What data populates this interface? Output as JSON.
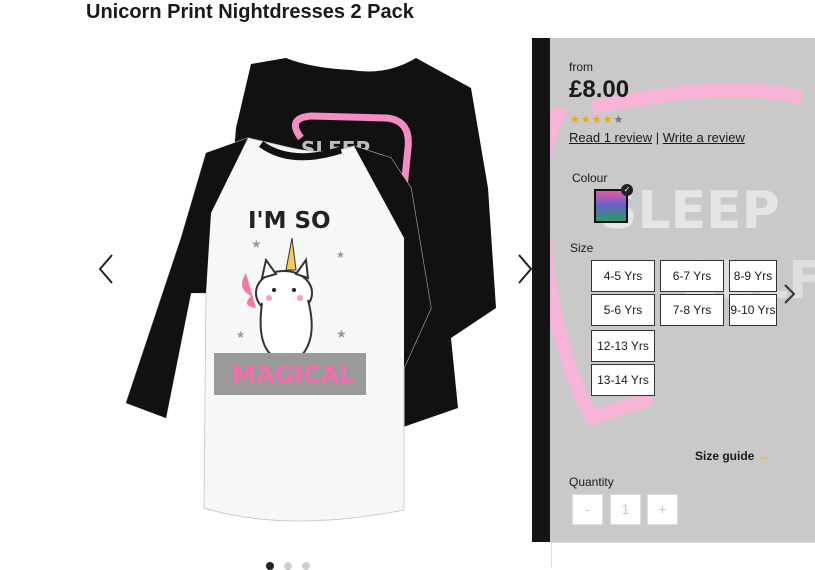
{
  "product": {
    "title": "Unicorn Print Nightdresses 2 Pack",
    "price_from": "from",
    "price": "£8.00",
    "rating": 4,
    "rating_max": 5,
    "review_link": "Read 1 review",
    "review_separator": "|",
    "write_review": "Write a review"
  },
  "gallery": {
    "front_text_top": "I'M SO",
    "front_text_bottom": "MAGICAL",
    "back_text": "SLEEP",
    "dots": [
      true,
      false,
      false
    ]
  },
  "options": {
    "colour_label": "Colour",
    "size_label": "Size",
    "sizes": [
      "4-5 Yrs",
      "6-7 Yrs",
      "8-9 Yrs",
      "5-6 Yrs",
      "7-8 Yrs",
      "9-10 Yrs",
      "12-13 Yrs",
      "13-14 Yrs"
    ],
    "size_guide": "Size guide",
    "size_guide_arrow": "→"
  },
  "quantity": {
    "label": "Quantity",
    "minus": "-",
    "value": "1",
    "plus": "+"
  },
  "panel_bg_text": [
    "SLEEP",
    "SELFIE"
  ],
  "colors": {
    "accent": "#f2a413",
    "pink": "#f06fae",
    "panel": "#c9c9c9"
  }
}
